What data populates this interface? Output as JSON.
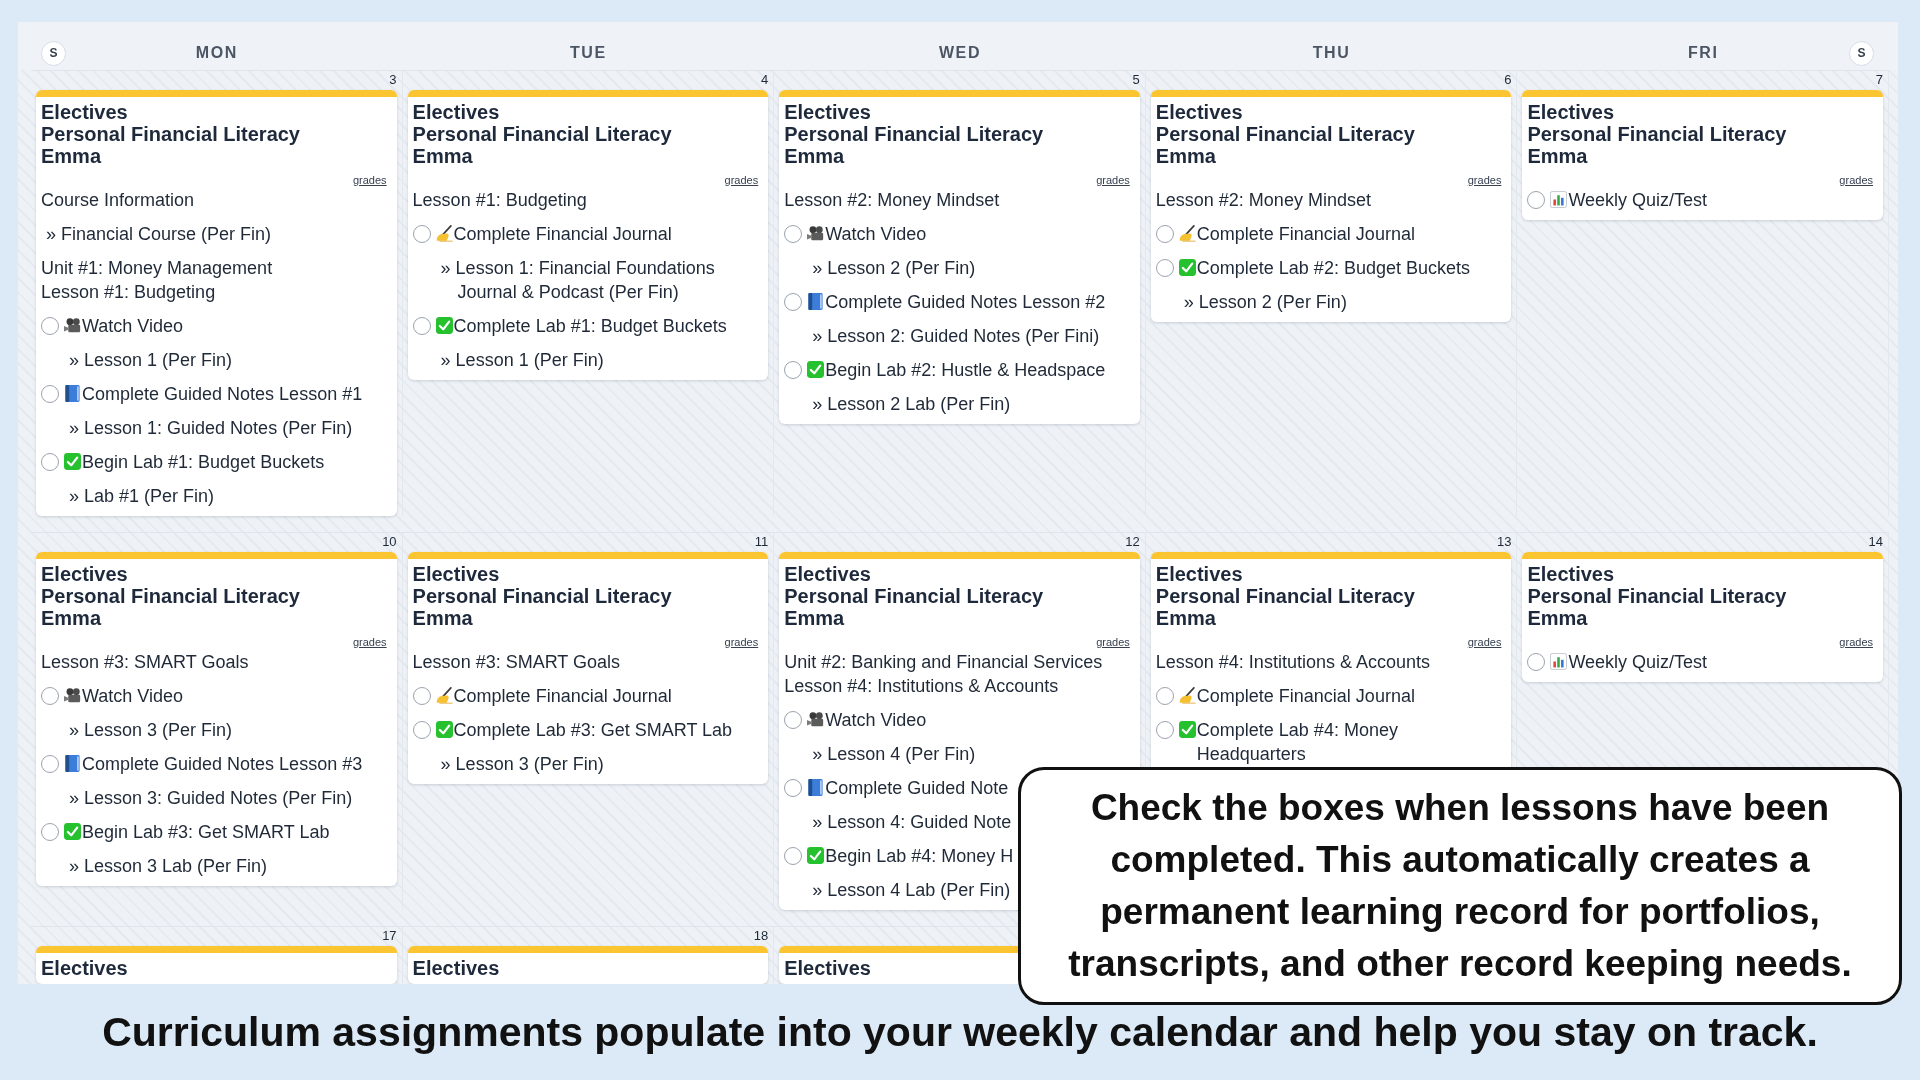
{
  "header": {
    "start_toggle": {
      "label": "S"
    },
    "days": [
      {
        "label": "MON"
      },
      {
        "label": "TUE"
      },
      {
        "label": "WED"
      },
      {
        "label": "THU"
      },
      {
        "label": "FRI"
      }
    ],
    "end_toggle": {
      "label": "S"
    }
  },
  "weeks": [
    {
      "cells": [
        {
          "date": "3",
          "card": {
            "category": "Electives",
            "course": "Personal Financial Literacy",
            "student": "Emma",
            "grades_link": "grades",
            "items": [
              {
                "kind": "heading",
                "lines": [
                  "Course Information"
                ]
              },
              {
                "kind": "link",
                "text": "» Financial Course (Per Fin)"
              },
              {
                "kind": "heading",
                "lines": [
                  "Unit #1: Money Management",
                  "Lesson #1: Budgeting"
                ]
              },
              {
                "kind": "video",
                "text": "Watch Video",
                "checked": false,
                "links": [
                  "» Lesson 1 (Per Fin)"
                ]
              },
              {
                "kind": "notes",
                "text": "Complete Guided Notes Lesson #1",
                "checked": false,
                "links": [
                  "» Lesson 1: Guided Notes (Per Fin)"
                ]
              },
              {
                "kind": "lab",
                "text": "Begin Lab #1: Budget Buckets",
                "checked": false,
                "links": [
                  "» Lab #1 (Per Fin)"
                ]
              }
            ]
          }
        },
        {
          "date": "4",
          "card": {
            "category": "Electives",
            "course": "Personal Financial Literacy",
            "student": "Emma",
            "grades_link": "grades",
            "items": [
              {
                "kind": "heading",
                "lines": [
                  "Lesson #1: Budgeting"
                ]
              },
              {
                "kind": "journal",
                "text": "Complete Financial Journal",
                "checked": false,
                "links": [
                  "» Lesson 1: Financial Foundations Journal & Podcast (Per Fin)"
                ]
              },
              {
                "kind": "lab",
                "text": "Complete Lab #1: Budget Buckets",
                "checked": false,
                "links": [
                  "» Lesson 1 (Per Fin)"
                ]
              }
            ]
          }
        },
        {
          "date": "5",
          "card": {
            "category": "Electives",
            "course": "Personal Financial Literacy",
            "student": "Emma",
            "grades_link": "grades",
            "items": [
              {
                "kind": "heading",
                "lines": [
                  "Lesson #2: Money Mindset"
                ]
              },
              {
                "kind": "video",
                "text": "Watch Video",
                "checked": false,
                "links": [
                  "» Lesson 2 (Per Fin)"
                ]
              },
              {
                "kind": "notes",
                "text": "Complete Guided Notes Lesson #2",
                "checked": false,
                "links": [
                  "» Lesson 2: Guided Notes (Per Fini)"
                ]
              },
              {
                "kind": "lab",
                "text": "Begin Lab #2: Hustle & Headspace",
                "checked": false,
                "links": [
                  "» Lesson 2 Lab (Per Fin)"
                ]
              }
            ]
          }
        },
        {
          "date": "6",
          "card": {
            "category": "Electives",
            "course": "Personal Financial Literacy",
            "student": "Emma",
            "grades_link": "grades",
            "items": [
              {
                "kind": "heading",
                "lines": [
                  "Lesson #2: Money Mindset"
                ]
              },
              {
                "kind": "journal",
                "text": "Complete Financial Journal",
                "checked": false
              },
              {
                "kind": "lab",
                "text": "Complete Lab #2: Budget Buckets",
                "checked": false,
                "links": [
                  "» Lesson 2 (Per Fin)"
                ]
              }
            ]
          }
        },
        {
          "date": "7",
          "card": {
            "category": "Electives",
            "course": "Personal Financial Literacy",
            "student": "Emma",
            "grades_link": "grades",
            "items": [
              {
                "kind": "quiz",
                "text": "Weekly Quiz/Test",
                "checked": false
              }
            ]
          }
        }
      ]
    },
    {
      "cells": [
        {
          "date": "10",
          "card": {
            "category": "Electives",
            "course": "Personal Financial Literacy",
            "student": "Emma",
            "grades_link": "grades",
            "items": [
              {
                "kind": "heading",
                "lines": [
                  "Lesson #3: SMART Goals"
                ]
              },
              {
                "kind": "video",
                "text": "Watch Video",
                "checked": false,
                "links": [
                  "» Lesson 3 (Per Fin)"
                ]
              },
              {
                "kind": "notes",
                "text": "Complete Guided Notes Lesson #3",
                "checked": false,
                "links": [
                  "» Lesson 3: Guided Notes (Per Fin)"
                ]
              },
              {
                "kind": "lab",
                "text": "Begin Lab #3: Get SMART Lab",
                "checked": false,
                "links": [
                  "» Lesson 3 Lab (Per Fin)"
                ]
              }
            ]
          }
        },
        {
          "date": "11",
          "card": {
            "category": "Electives",
            "course": "Personal Financial Literacy",
            "student": "Emma",
            "grades_link": "grades",
            "items": [
              {
                "kind": "heading",
                "lines": [
                  "Lesson #3: SMART Goals"
                ]
              },
              {
                "kind": "journal",
                "text": "Complete Financial Journal",
                "checked": false
              },
              {
                "kind": "lab",
                "text": "Complete Lab #3: Get SMART Lab",
                "checked": false,
                "links": [
                  "» Lesson 3 (Per Fin)"
                ]
              }
            ]
          }
        },
        {
          "date": "12",
          "card": {
            "category": "Electives",
            "course": "Personal Financial Literacy",
            "student": "Emma",
            "grades_link": "grades",
            "items": [
              {
                "kind": "heading",
                "lines": [
                  "Unit #2: Banking and Financial Services",
                  "Lesson #4: Institutions & Accounts"
                ]
              },
              {
                "kind": "video",
                "text": "Watch Video",
                "checked": false,
                "links": [
                  "» Lesson 4 (Per Fin)"
                ]
              },
              {
                "kind": "notes",
                "text": "Complete Guided Note",
                "checked": false,
                "links": [
                  "» Lesson 4: Guided Note"
                ]
              },
              {
                "kind": "lab",
                "text": "Begin Lab #4: Money H",
                "checked": false,
                "links": [
                  "» Lesson 4 Lab (Per Fin)"
                ]
              }
            ]
          }
        },
        {
          "date": "13",
          "card": {
            "category": "Electives",
            "course": "Personal Financial Literacy",
            "student": "Emma",
            "grades_link": "grades",
            "items": [
              {
                "kind": "heading",
                "lines": [
                  "Lesson #4: Institutions & Accounts"
                ]
              },
              {
                "kind": "journal",
                "text": "Complete Financial Journal",
                "checked": false
              },
              {
                "kind": "lab",
                "text": "Complete Lab #4: Money Headquarters",
                "checked": false
              }
            ]
          }
        },
        {
          "date": "14",
          "card": {
            "category": "Electives",
            "course": "Personal Financial Literacy",
            "student": "Emma",
            "grades_link": "grades",
            "items": [
              {
                "kind": "quiz",
                "text": "Weekly Quiz/Test",
                "checked": false
              }
            ]
          }
        }
      ]
    },
    {
      "cells": [
        {
          "date": "17",
          "card": {
            "category": "Electives"
          }
        },
        {
          "date": "18",
          "card": {
            "category": "Electives"
          }
        },
        {
          "card": {
            "category": "Electives"
          }
        }
      ]
    }
  ],
  "callout": {
    "text": "Check the boxes when lessons have been completed. This automatically creates a permanent learning record for portfolios, transcripts, and other record keeping needs."
  },
  "caption": "Curriculum assignments populate into your weekly calendar and help you stay on track."
}
